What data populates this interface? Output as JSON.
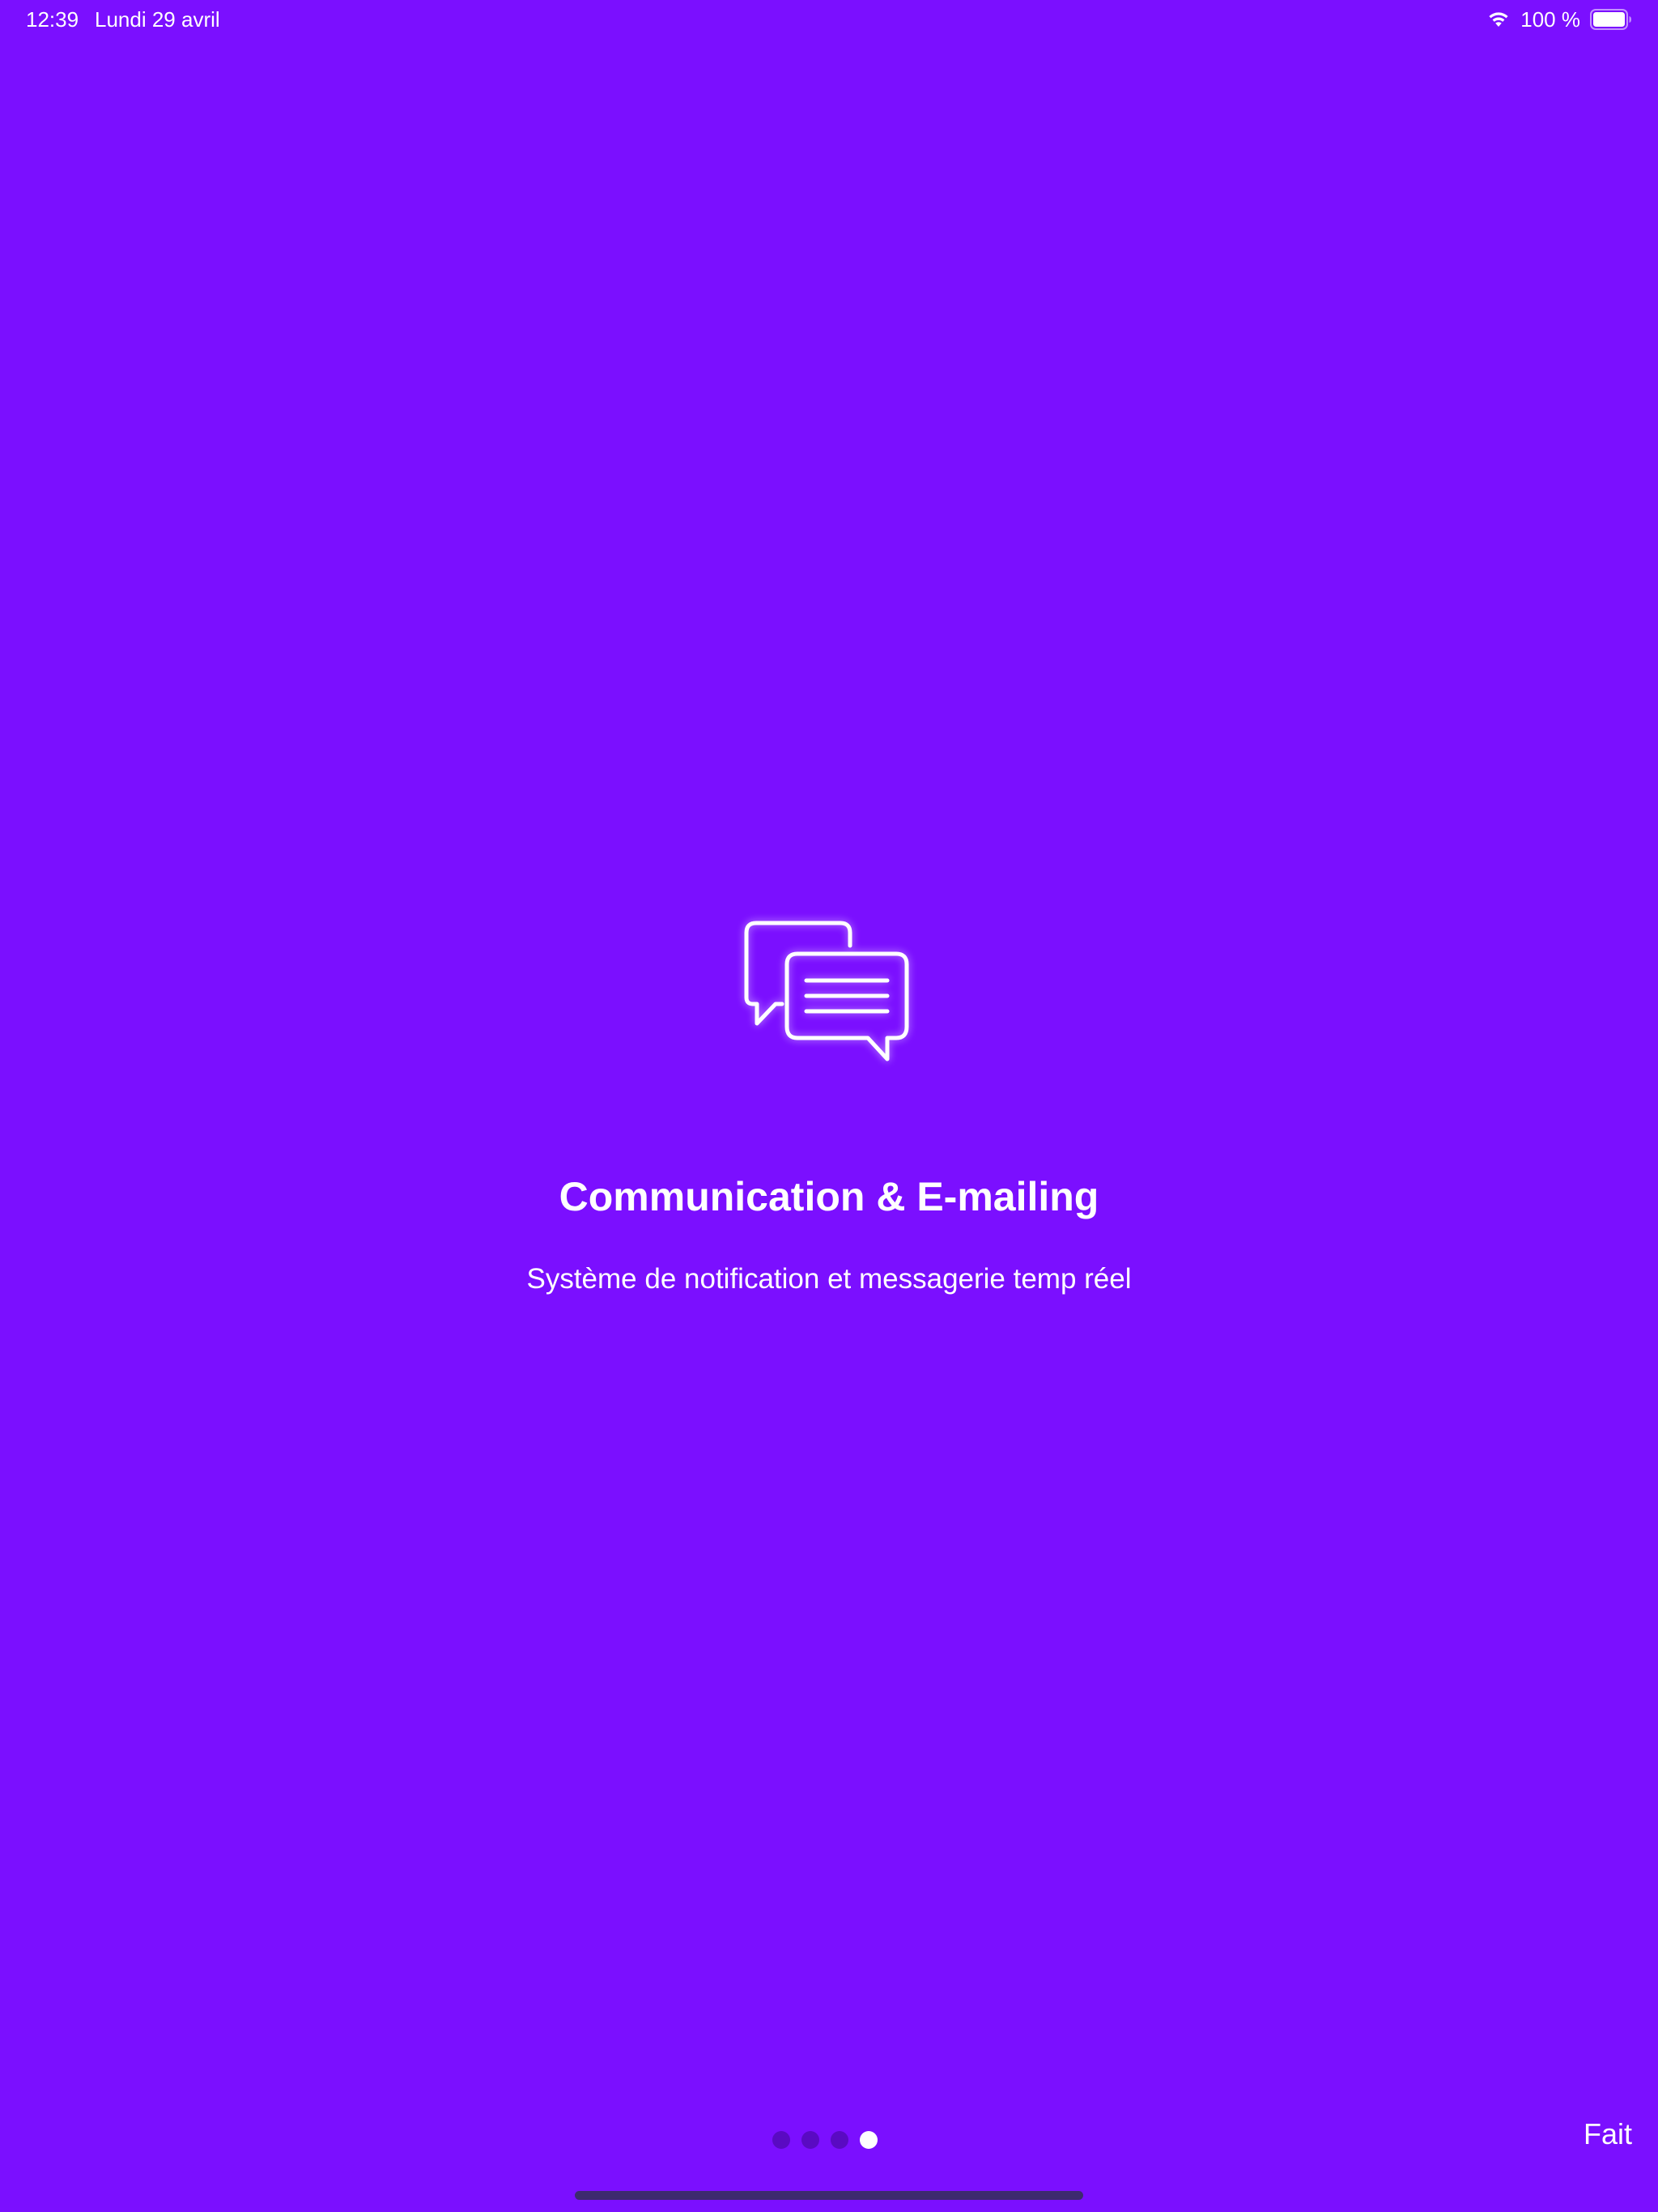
{
  "status_bar": {
    "time": "12:39",
    "date": "Lundi 29 avril",
    "battery_percent": "100 %",
    "battery_level": 1.0,
    "icons": [
      "wifi-icon",
      "battery-icon"
    ]
  },
  "onboarding": {
    "icon": "chat-bubbles-icon",
    "title": "Communication & E-mailing",
    "subtitle": "Système de notification et messagerie temp réel"
  },
  "page_control": {
    "total_pages": 4,
    "current_page": 4
  },
  "done_label": "Fait",
  "colors": {
    "background": "#7B0FFF",
    "text": "#FFFFFF",
    "dot_inactive": "#5A0AC2",
    "dot_active": "#FFFFFF",
    "home_indicator": "#3D2A6E"
  }
}
